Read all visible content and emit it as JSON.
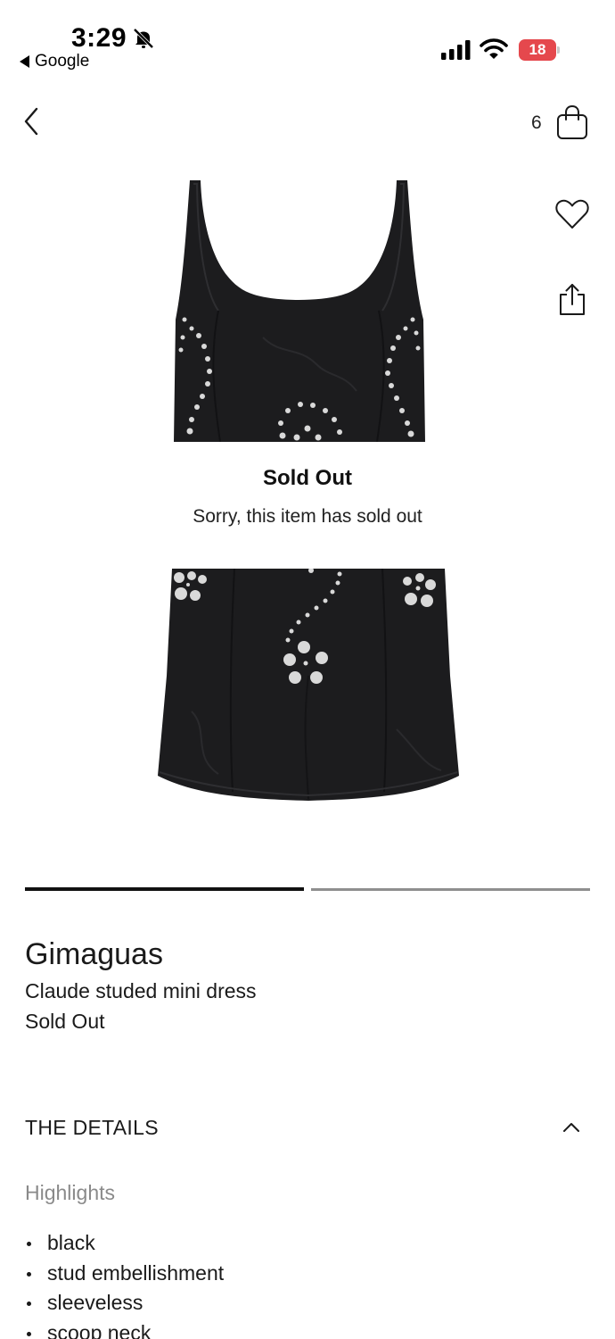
{
  "status_bar": {
    "time": "3:29",
    "back_app": "Google",
    "battery": "18"
  },
  "header": {
    "bag_count": "6"
  },
  "notice": {
    "title": "Sold Out",
    "message": "Sorry, this item has sold out"
  },
  "gallery": {
    "total_images": 2,
    "active_index": 0
  },
  "product": {
    "brand": "Gimaguas",
    "name": "Claude studed mini dress",
    "status": "Sold Out"
  },
  "details": {
    "title": "THE DETAILS",
    "expanded": true,
    "highlights_title": "Highlights",
    "highlights": [
      "black",
      "stud embellishment",
      "sleeveless",
      "scoop neck"
    ]
  },
  "icons": [
    "bell-slash-icon",
    "cellular-signal-icon",
    "wifi-icon",
    "battery-icon",
    "chevron-left-icon",
    "shopping-bag-icon",
    "heart-icon",
    "share-icon",
    "chevron-up-icon"
  ],
  "colors": {
    "text": "#1a1a1a",
    "muted": "#8a8a8a",
    "battery_low": "#e5484d",
    "indicator_active": "#111111",
    "indicator_inactive": "#8f8f8f"
  }
}
